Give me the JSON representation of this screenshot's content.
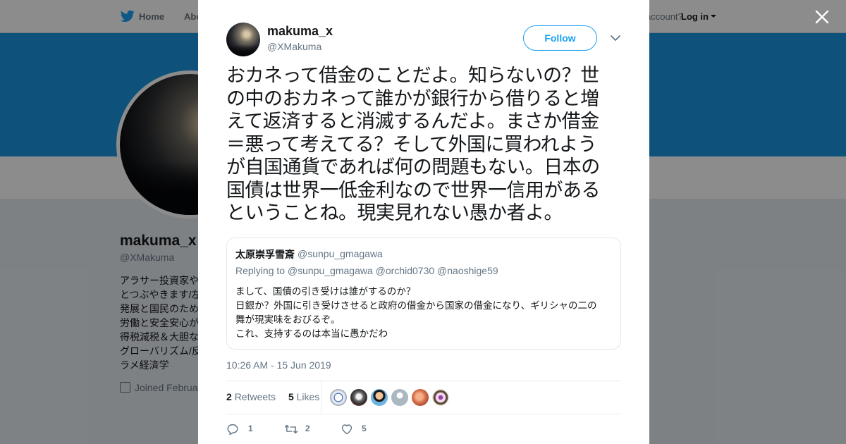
{
  "background": {
    "nav": {
      "home": "Home",
      "about": "Abo",
      "account_prompt": "account?",
      "login": "Log in"
    },
    "profile": {
      "name": "makuma_x",
      "handle": "@XMakuma",
      "bio_lines": [
        "アラサー投資家や",
        "とつぶやきます/左",
        "発展と国民のため",
        "労働と安全安心が",
        "得税減税＆大胆な",
        "グローバリズム/反",
        "ラメ経済学"
      ],
      "joined": "Joined Februa"
    },
    "colors": {
      "banner": "#1b95e0",
      "accent": "#1da1f2"
    }
  },
  "tweet": {
    "author": {
      "name": "makuma_x",
      "handle": "@XMakuma"
    },
    "follow_label": "Follow",
    "text_lines": [
      "おカネって借金のことだよ。知らないの？世",
      "の中のおカネって誰かが銀行から借りると増",
      "えて返済すると消滅するんだよ。まさか借金",
      "＝悪って考えてる？そして外国に買われよう",
      "が自国通貨であれば何の問題もない。日本の",
      "国債は世界一低金利なので世界一信用がある",
      "ということね。現実見れない愚か者よ。"
    ],
    "quote": {
      "name": "太原崇孚雪斎",
      "handle": "@sunpu_gmagawa",
      "replying_to": "Replying to @sunpu_gmagawa @orchid0730 @naoshige59",
      "body_lines": [
        "まして、国債の引き受けは誰がするのか？",
        "日銀か？外国に引き受けさせると政府の借金から国家の借金になり、ギリシャの二の",
        "舞が現実味をおびるぞ。",
        "これ、支持するのは本当に愚かだわ"
      ]
    },
    "timestamp": "10:26 AM - 15 Jun 2019",
    "stats": {
      "retweets_count": "2",
      "retweets_label": "Retweets",
      "likes_count": "5",
      "likes_label": "Likes"
    },
    "likers": [
      "liker-1",
      "liker-2",
      "liker-3",
      "liker-4",
      "liker-5",
      "liker-6"
    ],
    "actions": {
      "reply_count": "1",
      "retweet_count": "2",
      "like_count": "5"
    }
  }
}
